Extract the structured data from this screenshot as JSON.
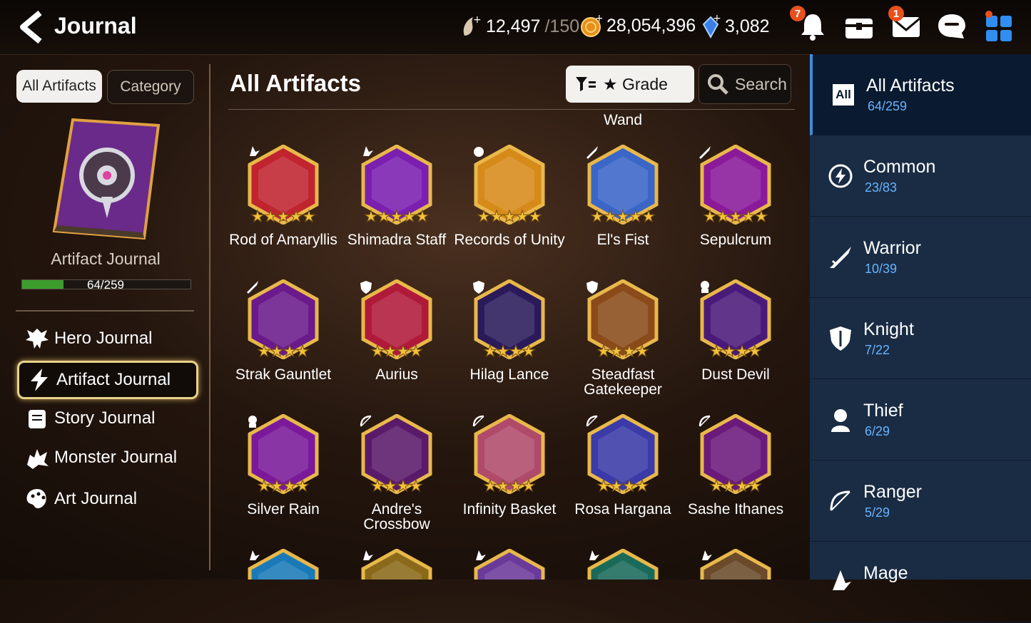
{
  "header": {
    "title": "Journal",
    "stamina": {
      "value": "12,497",
      "max": "/150"
    },
    "gold": "28,054,396",
    "crystals": "3,082",
    "bell_badge": "7",
    "mail_badge": "1"
  },
  "left": {
    "tabs": {
      "all": "All Artifacts",
      "category": "Category"
    },
    "journal_name": "Artifact Journal",
    "progress_text": "64/259",
    "progress_fraction": 0.247,
    "nav": [
      {
        "label": "Hero Journal",
        "icon": "hero-icon"
      },
      {
        "label": "Artifact Journal",
        "icon": "lightning-icon"
      },
      {
        "label": "Story Journal",
        "icon": "scroll-icon"
      },
      {
        "label": "Monster Journal",
        "icon": "monster-icon"
      },
      {
        "label": "Art Journal",
        "icon": "palette-icon"
      }
    ]
  },
  "center": {
    "title": "All Artifacts",
    "grade_label": "★ Grade",
    "search_label": "Search",
    "cut_top_row": [
      "",
      "",
      "",
      "Wand",
      ""
    ],
    "artifacts": [
      {
        "name": "Rod of Amaryllis",
        "stars": 5,
        "class": "mage",
        "color": "#c0242f"
      },
      {
        "name": "Shimadra Staff",
        "stars": 5,
        "class": "mage",
        "color": "#7a1fb0"
      },
      {
        "name": "Records of Unity",
        "stars": 5,
        "class": "all",
        "color": "#d68a1a"
      },
      {
        "name": "El's Fist",
        "stars": 5,
        "class": "warrior",
        "color": "#3a66c8"
      },
      {
        "name": "Sepulcrum",
        "stars": 5,
        "class": "warrior",
        "color": "#8a1a9a"
      },
      {
        "name": "Strak Gauntlet",
        "stars": 4,
        "class": "warrior",
        "color": "#6a1a8a"
      },
      {
        "name": "Aurius",
        "stars": 4,
        "class": "knight",
        "color": "#b01a3a"
      },
      {
        "name": "Hilag Lance",
        "stars": 4,
        "class": "knight",
        "color": "#2a1a5a"
      },
      {
        "name": "Steadfast Gatekeeper",
        "stars": 4,
        "class": "knight",
        "color": "#8a4a1a"
      },
      {
        "name": "Dust Devil",
        "stars": 4,
        "class": "thief",
        "color": "#4a1a7a"
      },
      {
        "name": "Silver Rain",
        "stars": 4,
        "class": "thief",
        "color": "#7a1a9a"
      },
      {
        "name": "Andre's Crossbow",
        "stars": 4,
        "class": "ranger",
        "color": "#5a1a6a"
      },
      {
        "name": "Infinity Basket",
        "stars": 4,
        "class": "ranger",
        "color": "#b04a6a"
      },
      {
        "name": "Rosa Hargana",
        "stars": 4,
        "class": "ranger",
        "color": "#3a3aa8"
      },
      {
        "name": "Sashe Ithanes",
        "stars": 4,
        "class": "ranger",
        "color": "#6a1a7a"
      }
    ],
    "bottom_row_colors": [
      "#1a7ab8",
      "#8a6a1a",
      "#6a3a9a",
      "#1a6a5a",
      "#6a4a2a"
    ]
  },
  "right": {
    "items": [
      {
        "label": "All Artifacts",
        "count": "64/259",
        "icon": "all-icon"
      },
      {
        "label": "Common",
        "count": "23/83",
        "icon": "common-icon"
      },
      {
        "label": "Warrior",
        "count": "10/39",
        "icon": "warrior-icon"
      },
      {
        "label": "Knight",
        "count": "7/22",
        "icon": "knight-icon"
      },
      {
        "label": "Thief",
        "count": "6/29",
        "icon": "thief-icon"
      },
      {
        "label": "Ranger",
        "count": "5/29",
        "icon": "ranger-icon"
      },
      {
        "label": "Mage",
        "count": "",
        "icon": "mage-icon"
      }
    ],
    "all_box_text": "All"
  }
}
